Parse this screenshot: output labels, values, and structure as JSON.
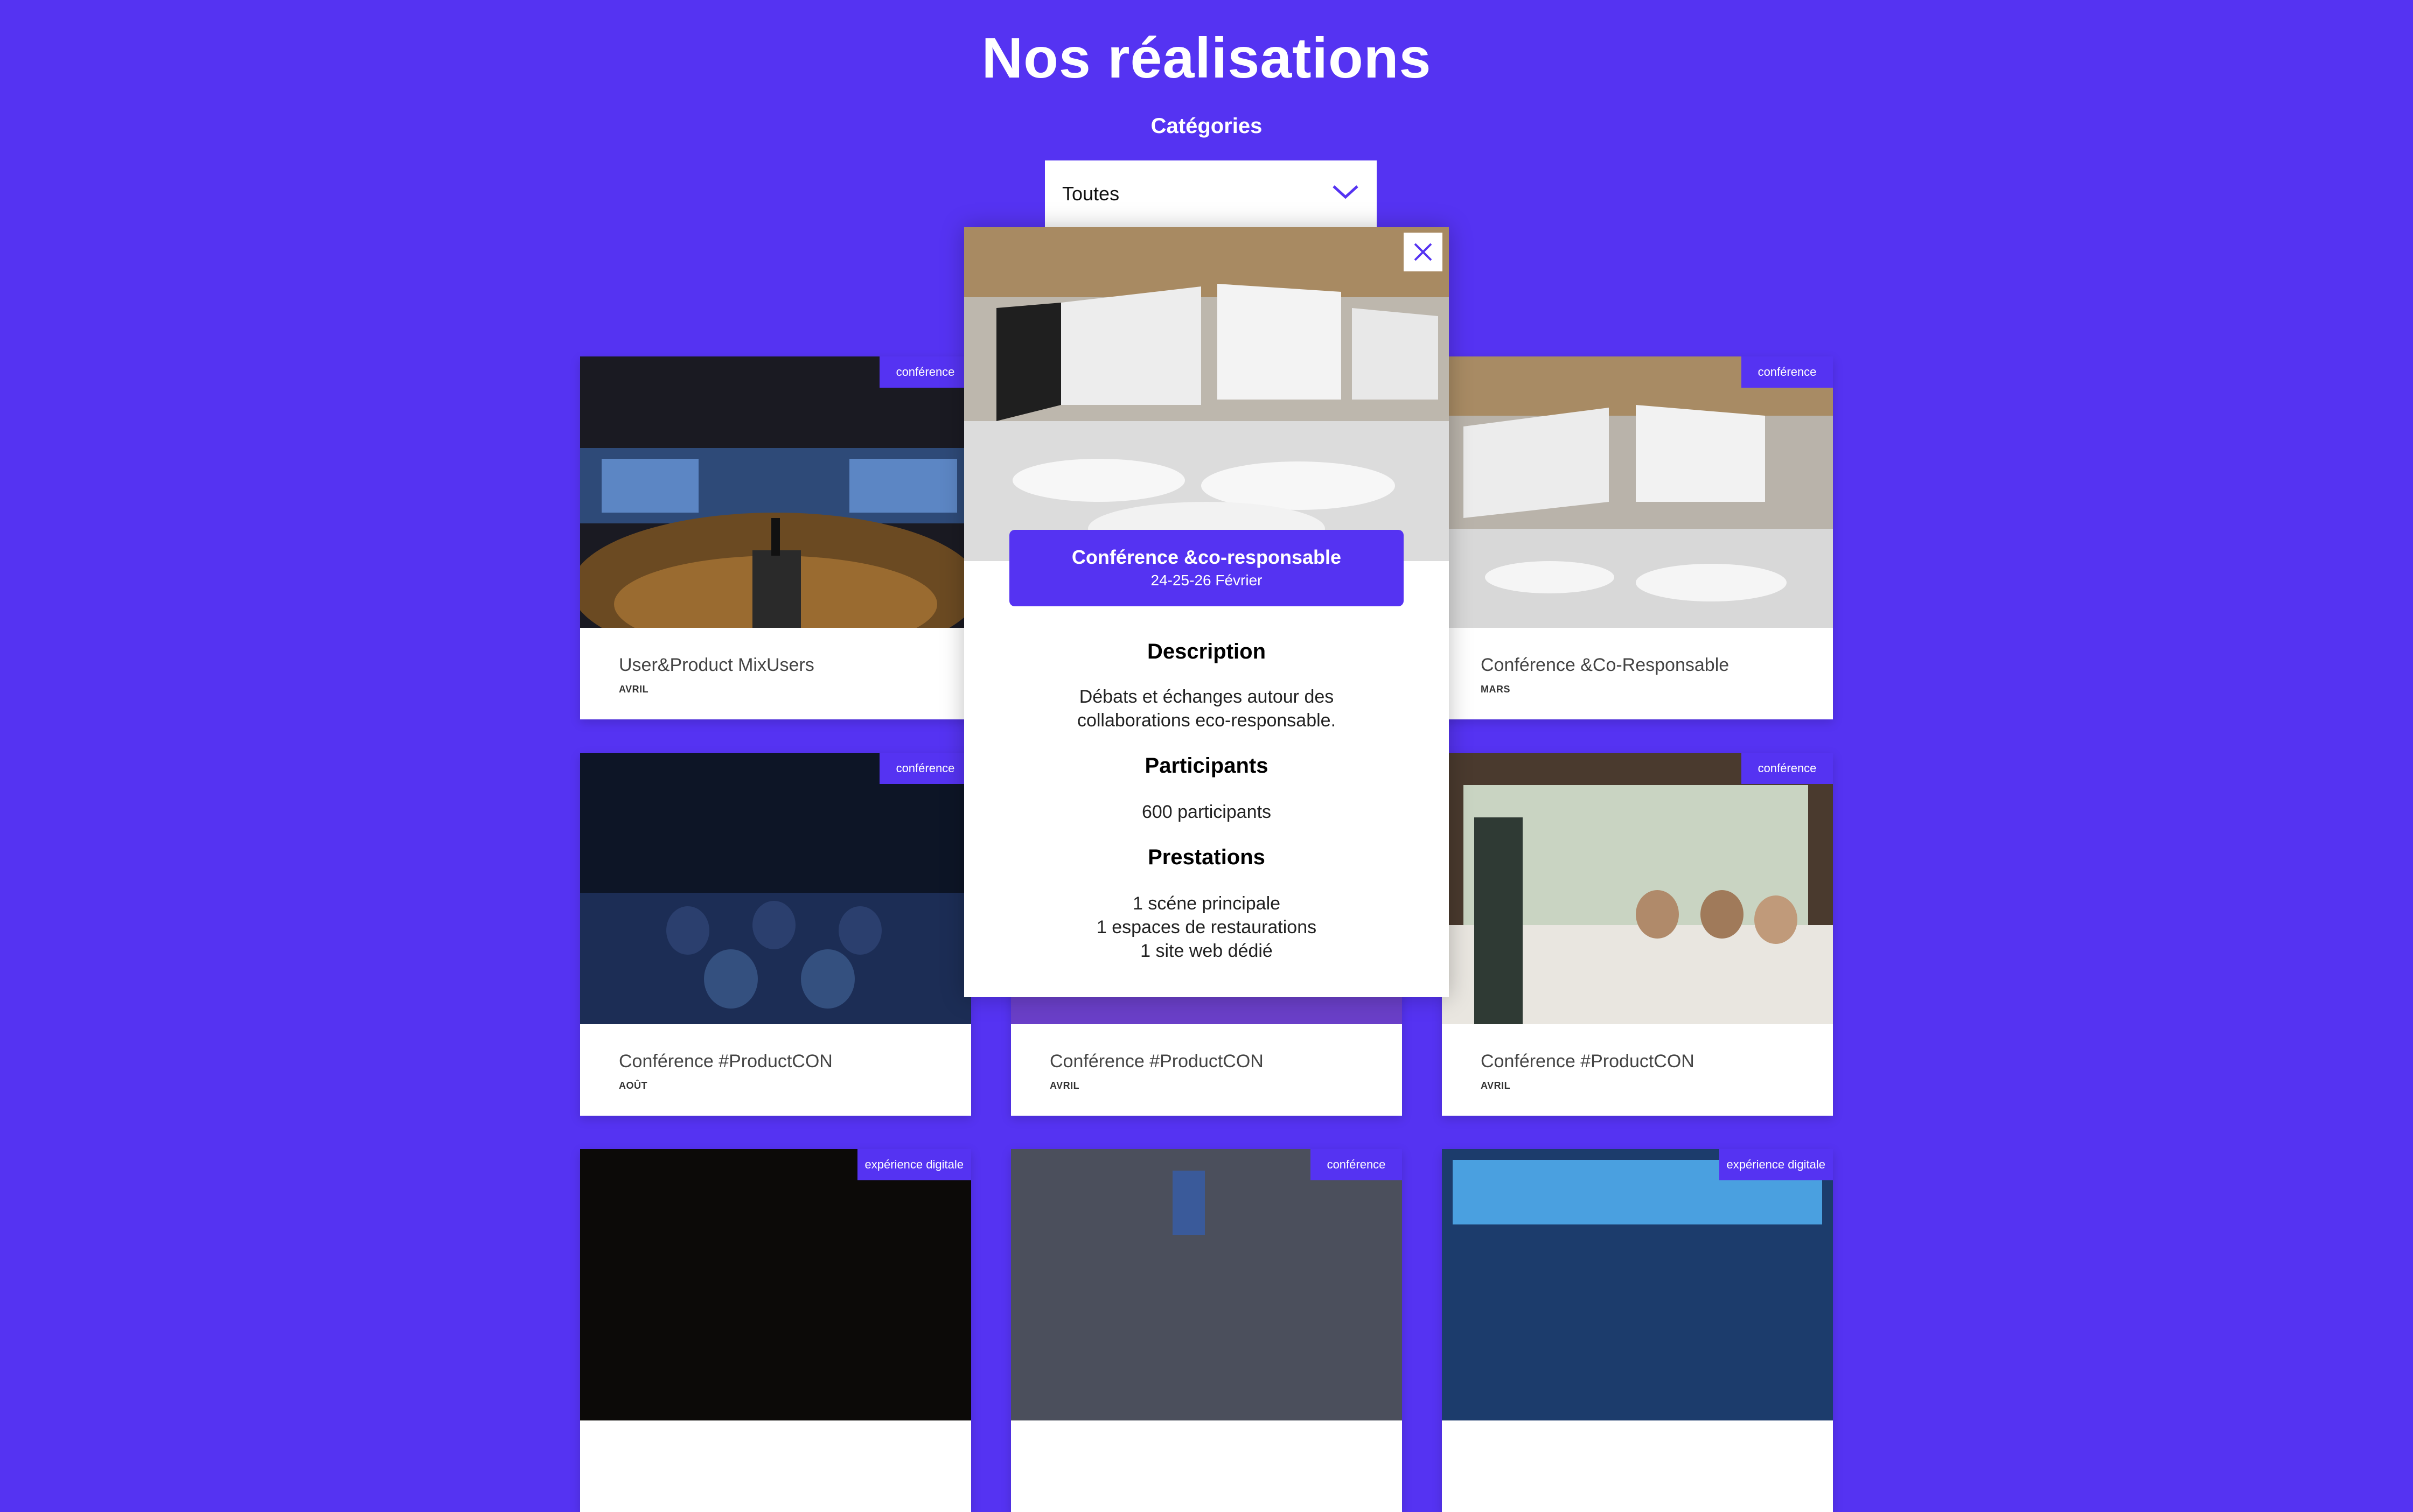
{
  "page": {
    "title": "Nos réalisations"
  },
  "filter": {
    "label": "Catégories",
    "selected": "Toutes"
  },
  "cards": [
    {
      "badge": "conférence",
      "title": "User&Product MixUsers",
      "month": "AVRIL"
    },
    {
      "badge": "conférence",
      "title": "Conférence &Co-Responsable",
      "month": "MARS"
    },
    {
      "badge": "conférence",
      "title": "Conférence #ProductCON",
      "month": "AOÛT"
    },
    {
      "badge": "",
      "title": "Conférence #ProductCON",
      "month": "AVRIL"
    },
    {
      "badge": "conférence",
      "title": "Conférence #ProductCON",
      "month": "AVRIL"
    },
    {
      "badge": "expérience digitale",
      "title": "",
      "month": ""
    },
    {
      "badge": "conférence",
      "title": "",
      "month": ""
    },
    {
      "badge": "expérience digitale",
      "title": "",
      "month": ""
    }
  ],
  "modal": {
    "event_name": "Conférence &co-responsable",
    "event_dates": "24-25-26 Février",
    "description_heading": "Description",
    "description_lines": [
      "Débats et échanges autour des",
      "collaborations eco-responsable."
    ],
    "participants_heading": "Participants",
    "participants": "600 participants",
    "prestations_heading": "Prestations",
    "prestations": [
      "1 scéne principale",
      "1 espaces de restaurations",
      "1 site web dédié"
    ]
  },
  "colors": {
    "brand": "#5533f2",
    "card_bg": "#ffffff"
  }
}
